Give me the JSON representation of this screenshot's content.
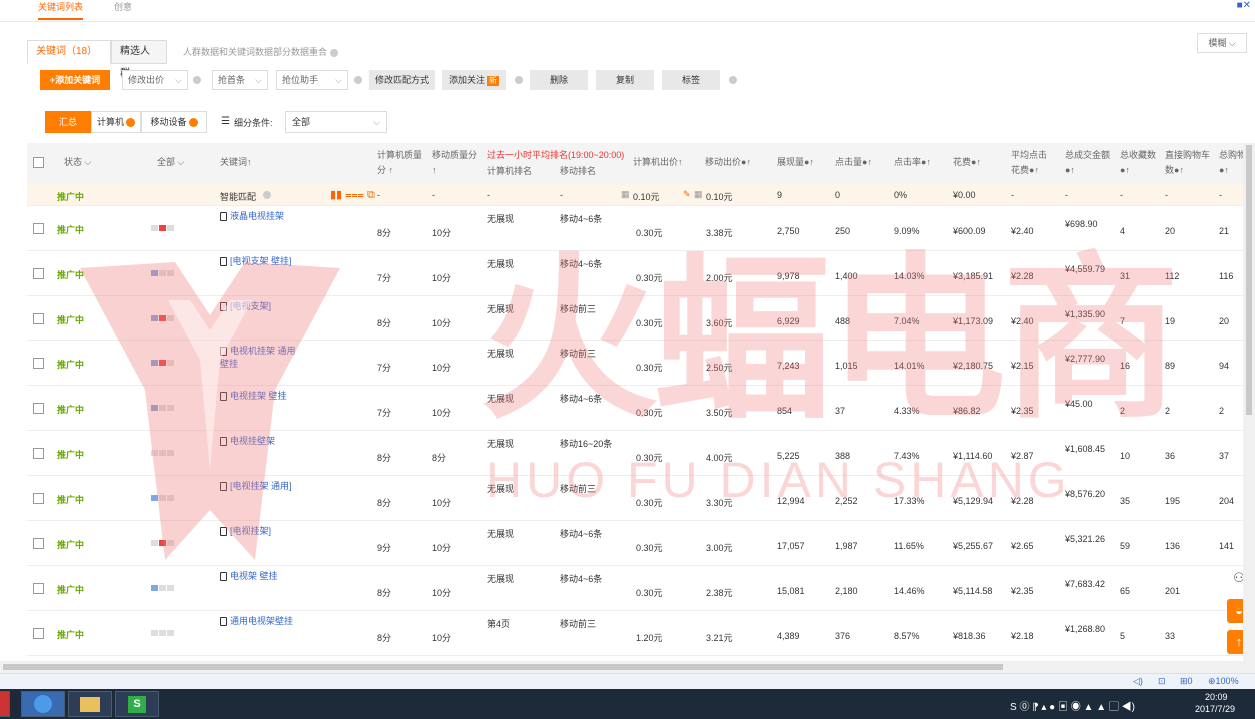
{
  "top_tabs": [
    {
      "label": "关键词列表"
    },
    {
      "label": "创意"
    }
  ],
  "kw_tabs": [
    {
      "label": "关键词（18）"
    },
    {
      "label": "精选人群"
    }
  ],
  "kw_hint": "人群数据和关键词数据部分数据重合",
  "fuzzy_label": "模糊",
  "toolbar": {
    "add": "+添加关键词",
    "change_bid": "修改出价",
    "grab": "抢首条",
    "grab_helper": "抢位助手",
    "match": "修改匹配方式",
    "follow": "添加关注",
    "new_tag": "新",
    "delete": "删除",
    "copy": "复制",
    "tag": "标签"
  },
  "segments": {
    "all": "汇总",
    "pc": "计算机",
    "mobile": "移动设备"
  },
  "filter": {
    "label": "细分条件:",
    "value": "全部"
  },
  "headers": {
    "status": "状态",
    "all": "全部",
    "keyword": "关键词",
    "pc_quality": "计算机质量分",
    "mobile_quality": "移动质量分",
    "hour_rank": "过去一小时平均排名(19:00~20:00)",
    "pc_rank": "计算机排名",
    "mobile_rank": "移动排名",
    "pc_bid": "计算机出价",
    "mobile_bid": "移动出价",
    "impressions": "展现量",
    "clicks": "点击量",
    "ctr": "点击率",
    "cost": "花费",
    "cpc": "平均点击花费",
    "gmv": "总成交金额",
    "fav": "总收藏数",
    "cart": "直接购物车数",
    "total_cart": "总购物"
  },
  "smart": {
    "status": "推广中",
    "keyword": "智能匹配",
    "pc_quality": "-",
    "mobile_quality": "-",
    "pc_rank": "-",
    "mobile_rank": "-",
    "pc_bid": "0.10元",
    "mobile_bid": "0.10元",
    "impressions": "9",
    "clicks": "0",
    "ctr": "0%",
    "cost": "¥0.00",
    "cpc": "-",
    "gmv": "-",
    "fav": "-",
    "cart": "-",
    "total_cart": "-"
  },
  "rows": [
    {
      "status": "推广中",
      "keyword": "液晶电视挂架",
      "pc_quality": "8分",
      "mobile_quality": "10分",
      "pc_rank": "无展现",
      "mobile_rank": "移动4~6条",
      "pc_bid": "0.30元",
      "mobile_bid": "3.38元",
      "impressions": "2,750",
      "clicks": "250",
      "ctr": "9.09%",
      "cost": "¥600.09",
      "cpc": "¥2.40",
      "gmv": "¥698.90",
      "fav": "4",
      "cart": "20",
      "total_cart": "21"
    },
    {
      "status": "推广中",
      "keyword": "[电视支架 壁挂]",
      "pc_quality": "7分",
      "mobile_quality": "10分",
      "pc_rank": "无展现",
      "mobile_rank": "移动4~6条",
      "pc_bid": "0.30元",
      "mobile_bid": "2.00元",
      "impressions": "9,978",
      "clicks": "1,400",
      "ctr": "14.03%",
      "cost": "¥3,185.91",
      "cpc": "¥2.28",
      "gmv": "¥4,559.79",
      "fav": "31",
      "cart": "112",
      "total_cart": "116"
    },
    {
      "status": "推广中",
      "keyword": "[电视支架]",
      "pc_quality": "8分",
      "mobile_quality": "10分",
      "pc_rank": "无展现",
      "mobile_rank": "移动前三",
      "pc_bid": "0.30元",
      "mobile_bid": "3.60元",
      "impressions": "6,929",
      "clicks": "488",
      "ctr": "7.04%",
      "cost": "¥1,173.09",
      "cpc": "¥2.40",
      "gmv": "¥1,335.90",
      "fav": "7",
      "cart": "19",
      "total_cart": "20"
    },
    {
      "status": "推广中",
      "keyword": "电视机挂架 通用 壁挂",
      "pc_quality": "7分",
      "mobile_quality": "10分",
      "pc_rank": "无展现",
      "mobile_rank": "移动前三",
      "pc_bid": "0.30元",
      "mobile_bid": "2.50元",
      "impressions": "7,243",
      "clicks": "1,015",
      "ctr": "14.01%",
      "cost": "¥2,180.75",
      "cpc": "¥2.15",
      "gmv": "¥2,777.90",
      "fav": "16",
      "cart": "89",
      "total_cart": "94"
    },
    {
      "status": "推广中",
      "keyword": "电视挂架 壁挂",
      "pc_quality": "7分",
      "mobile_quality": "10分",
      "pc_rank": "无展现",
      "mobile_rank": "移动4~6条",
      "pc_bid": "0.30元",
      "mobile_bid": "3.50元",
      "impressions": "854",
      "clicks": "37",
      "ctr": "4.33%",
      "cost": "¥86.82",
      "cpc": "¥2.35",
      "gmv": "¥45.00",
      "fav": "2",
      "cart": "2",
      "total_cart": "2"
    },
    {
      "status": "推广中",
      "keyword": "电视挂壁架",
      "pc_quality": "8分",
      "mobile_quality": "8分",
      "pc_rank": "无展现",
      "mobile_rank": "移动16~20条",
      "pc_bid": "0.30元",
      "mobile_bid": "4.00元",
      "impressions": "5,225",
      "clicks": "388",
      "ctr": "7.43%",
      "cost": "¥1,114.60",
      "cpc": "¥2.87",
      "gmv": "¥1,608.45",
      "fav": "10",
      "cart": "36",
      "total_cart": "37"
    },
    {
      "status": "推广中",
      "keyword": "[电视挂架 通用]",
      "pc_quality": "8分",
      "mobile_quality": "10分",
      "pc_rank": "无展现",
      "mobile_rank": "移动前三",
      "pc_bid": "0.30元",
      "mobile_bid": "3.30元",
      "impressions": "12,994",
      "clicks": "2,252",
      "ctr": "17.33%",
      "cost": "¥5,129.94",
      "cpc": "¥2.28",
      "gmv": "¥8,576.20",
      "fav": "35",
      "cart": "195",
      "total_cart": "204"
    },
    {
      "status": "推广中",
      "keyword": "[电视挂架]",
      "pc_quality": "9分",
      "mobile_quality": "10分",
      "pc_rank": "无展现",
      "mobile_rank": "移动4~6条",
      "pc_bid": "0.30元",
      "mobile_bid": "3.00元",
      "impressions": "17,057",
      "clicks": "1,987",
      "ctr": "11.65%",
      "cost": "¥5,255.67",
      "cpc": "¥2.65",
      "gmv": "¥5,321.26",
      "fav": "59",
      "cart": "136",
      "total_cart": "141"
    },
    {
      "status": "推广中",
      "keyword": "电视架 壁挂",
      "pc_quality": "8分",
      "mobile_quality": "10分",
      "pc_rank": "无展现",
      "mobile_rank": "移动4~6条",
      "pc_bid": "0.30元",
      "mobile_bid": "2.38元",
      "impressions": "15,081",
      "clicks": "2,180",
      "ctr": "14.46%",
      "cost": "¥5,114.58",
      "cpc": "¥2.35",
      "gmv": "¥7,683.42",
      "fav": "65",
      "cart": "201",
      "total_cart": ""
    },
    {
      "status": "推广中",
      "keyword": "通用电视架壁挂",
      "pc_quality": "8分",
      "mobile_quality": "10分",
      "pc_rank": "第4页",
      "mobile_rank": "移动前三",
      "pc_bid": "1.20元",
      "mobile_bid": "3.21元",
      "impressions": "4,389",
      "clicks": "376",
      "ctr": "8.57%",
      "cost": "¥818.36",
      "cpc": "¥2.18",
      "gmv": "¥1,268.80",
      "fav": "5",
      "cart": "33",
      "total_cart": ""
    }
  ],
  "row_bars": [
    [
      "g",
      "r",
      "g"
    ],
    [
      "b",
      "g",
      "g"
    ],
    [
      "b",
      "r",
      "g"
    ],
    [
      "b",
      "r",
      "g"
    ],
    [
      "b",
      "g",
      "g"
    ],
    [
      "g",
      "g",
      "g"
    ],
    [
      "b",
      "g",
      "g"
    ],
    [
      "g",
      "r",
      "g"
    ],
    [
      "b",
      "g",
      "g"
    ],
    [
      "g",
      "g",
      "g"
    ]
  ],
  "watermark": {
    "cn": "火蝠电商",
    "en": "HUO FU DIAN SHANG"
  },
  "statusbar": {
    "zoom": "100%",
    "downloads": "0"
  },
  "taskbar": {
    "time": "20:09",
    "date": "2017/7/29"
  },
  "colors": {
    "accent": "#ff7d00",
    "status_green": "#66aa00",
    "link": "#3366cc",
    "rank_red": "#ee3333",
    "watermark": "#f27a7a"
  }
}
